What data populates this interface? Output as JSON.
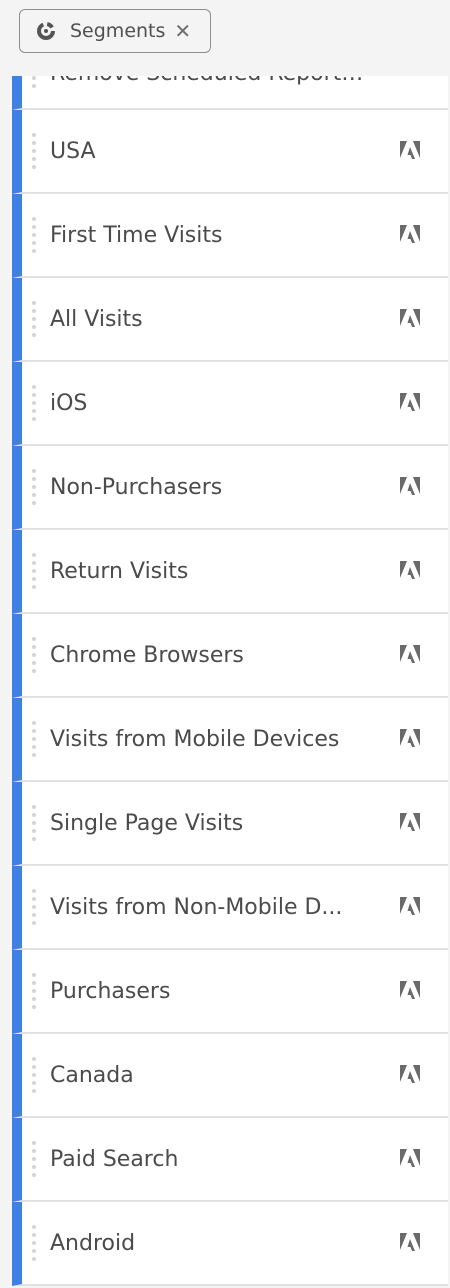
{
  "chip": {
    "label": "Segments",
    "icon": "segment-icon",
    "close_icon": "close-icon"
  },
  "partial_row": {
    "label": "Remove Scheduled Report Sh..."
  },
  "segments": [
    {
      "label": "USA"
    },
    {
      "label": "First Time Visits"
    },
    {
      "label": "All Visits"
    },
    {
      "label": "iOS"
    },
    {
      "label": "Non-Purchasers"
    },
    {
      "label": "Return Visits"
    },
    {
      "label": "Chrome Browsers"
    },
    {
      "label": "Visits from Mobile Devices"
    },
    {
      "label": "Single Page Visits"
    },
    {
      "label": "Visits from Non-Mobile D..."
    },
    {
      "label": "Purchasers"
    },
    {
      "label": "Canada"
    },
    {
      "label": "Paid Search"
    },
    {
      "label": "Android"
    }
  ],
  "colors": {
    "accent": "#3f80e4",
    "text": "#4b4b4b",
    "row_border": "#e1e1e1"
  }
}
